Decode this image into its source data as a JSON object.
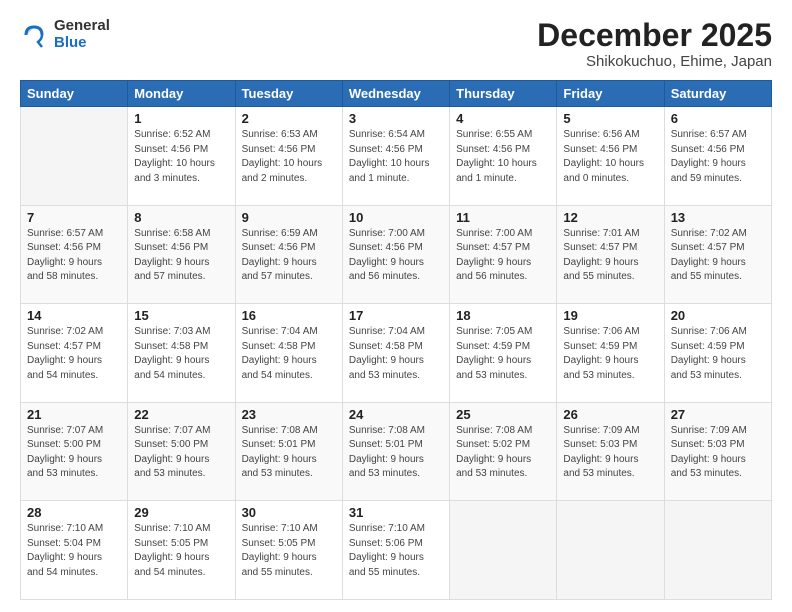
{
  "logo": {
    "general": "General",
    "blue": "Blue"
  },
  "header": {
    "month": "December 2025",
    "location": "Shikokuchuo, Ehime, Japan"
  },
  "weekdays": [
    "Sunday",
    "Monday",
    "Tuesday",
    "Wednesday",
    "Thursday",
    "Friday",
    "Saturday"
  ],
  "weeks": [
    [
      {
        "day": "",
        "info": ""
      },
      {
        "day": "1",
        "info": "Sunrise: 6:52 AM\nSunset: 4:56 PM\nDaylight: 10 hours\nand 3 minutes."
      },
      {
        "day": "2",
        "info": "Sunrise: 6:53 AM\nSunset: 4:56 PM\nDaylight: 10 hours\nand 2 minutes."
      },
      {
        "day": "3",
        "info": "Sunrise: 6:54 AM\nSunset: 4:56 PM\nDaylight: 10 hours\nand 1 minute."
      },
      {
        "day": "4",
        "info": "Sunrise: 6:55 AM\nSunset: 4:56 PM\nDaylight: 10 hours\nand 1 minute."
      },
      {
        "day": "5",
        "info": "Sunrise: 6:56 AM\nSunset: 4:56 PM\nDaylight: 10 hours\nand 0 minutes."
      },
      {
        "day": "6",
        "info": "Sunrise: 6:57 AM\nSunset: 4:56 PM\nDaylight: 9 hours\nand 59 minutes."
      }
    ],
    [
      {
        "day": "7",
        "info": "Sunrise: 6:57 AM\nSunset: 4:56 PM\nDaylight: 9 hours\nand 58 minutes."
      },
      {
        "day": "8",
        "info": "Sunrise: 6:58 AM\nSunset: 4:56 PM\nDaylight: 9 hours\nand 57 minutes."
      },
      {
        "day": "9",
        "info": "Sunrise: 6:59 AM\nSunset: 4:56 PM\nDaylight: 9 hours\nand 57 minutes."
      },
      {
        "day": "10",
        "info": "Sunrise: 7:00 AM\nSunset: 4:56 PM\nDaylight: 9 hours\nand 56 minutes."
      },
      {
        "day": "11",
        "info": "Sunrise: 7:00 AM\nSunset: 4:57 PM\nDaylight: 9 hours\nand 56 minutes."
      },
      {
        "day": "12",
        "info": "Sunrise: 7:01 AM\nSunset: 4:57 PM\nDaylight: 9 hours\nand 55 minutes."
      },
      {
        "day": "13",
        "info": "Sunrise: 7:02 AM\nSunset: 4:57 PM\nDaylight: 9 hours\nand 55 minutes."
      }
    ],
    [
      {
        "day": "14",
        "info": "Sunrise: 7:02 AM\nSunset: 4:57 PM\nDaylight: 9 hours\nand 54 minutes."
      },
      {
        "day": "15",
        "info": "Sunrise: 7:03 AM\nSunset: 4:58 PM\nDaylight: 9 hours\nand 54 minutes."
      },
      {
        "day": "16",
        "info": "Sunrise: 7:04 AM\nSunset: 4:58 PM\nDaylight: 9 hours\nand 54 minutes."
      },
      {
        "day": "17",
        "info": "Sunrise: 7:04 AM\nSunset: 4:58 PM\nDaylight: 9 hours\nand 53 minutes."
      },
      {
        "day": "18",
        "info": "Sunrise: 7:05 AM\nSunset: 4:59 PM\nDaylight: 9 hours\nand 53 minutes."
      },
      {
        "day": "19",
        "info": "Sunrise: 7:06 AM\nSunset: 4:59 PM\nDaylight: 9 hours\nand 53 minutes."
      },
      {
        "day": "20",
        "info": "Sunrise: 7:06 AM\nSunset: 4:59 PM\nDaylight: 9 hours\nand 53 minutes."
      }
    ],
    [
      {
        "day": "21",
        "info": "Sunrise: 7:07 AM\nSunset: 5:00 PM\nDaylight: 9 hours\nand 53 minutes."
      },
      {
        "day": "22",
        "info": "Sunrise: 7:07 AM\nSunset: 5:00 PM\nDaylight: 9 hours\nand 53 minutes."
      },
      {
        "day": "23",
        "info": "Sunrise: 7:08 AM\nSunset: 5:01 PM\nDaylight: 9 hours\nand 53 minutes."
      },
      {
        "day": "24",
        "info": "Sunrise: 7:08 AM\nSunset: 5:01 PM\nDaylight: 9 hours\nand 53 minutes."
      },
      {
        "day": "25",
        "info": "Sunrise: 7:08 AM\nSunset: 5:02 PM\nDaylight: 9 hours\nand 53 minutes."
      },
      {
        "day": "26",
        "info": "Sunrise: 7:09 AM\nSunset: 5:03 PM\nDaylight: 9 hours\nand 53 minutes."
      },
      {
        "day": "27",
        "info": "Sunrise: 7:09 AM\nSunset: 5:03 PM\nDaylight: 9 hours\nand 53 minutes."
      }
    ],
    [
      {
        "day": "28",
        "info": "Sunrise: 7:10 AM\nSunset: 5:04 PM\nDaylight: 9 hours\nand 54 minutes."
      },
      {
        "day": "29",
        "info": "Sunrise: 7:10 AM\nSunset: 5:05 PM\nDaylight: 9 hours\nand 54 minutes."
      },
      {
        "day": "30",
        "info": "Sunrise: 7:10 AM\nSunset: 5:05 PM\nDaylight: 9 hours\nand 55 minutes."
      },
      {
        "day": "31",
        "info": "Sunrise: 7:10 AM\nSunset: 5:06 PM\nDaylight: 9 hours\nand 55 minutes."
      },
      {
        "day": "",
        "info": ""
      },
      {
        "day": "",
        "info": ""
      },
      {
        "day": "",
        "info": ""
      }
    ]
  ]
}
